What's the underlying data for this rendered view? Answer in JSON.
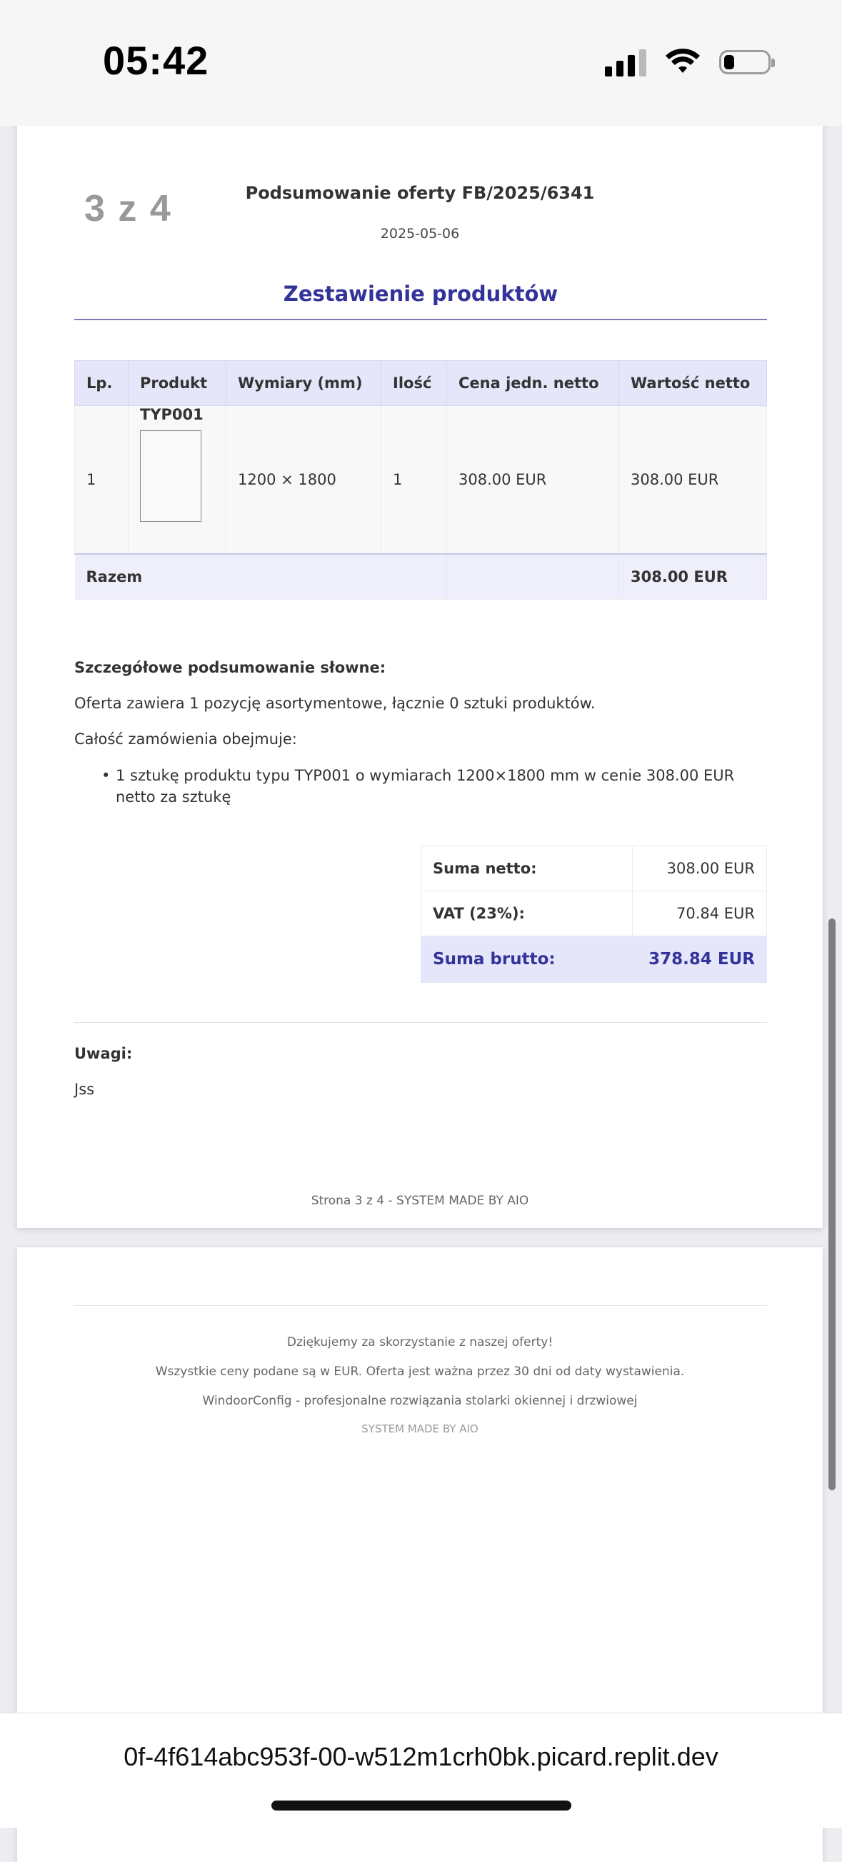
{
  "status_bar": {
    "time": "05:42",
    "icons": [
      "cellular-signal-icon",
      "wifi-icon",
      "battery-icon"
    ]
  },
  "page3": {
    "page_counter": "3 z 4",
    "title": "Podsumowanie oferty FB/2025/6341",
    "date": "2025-05-06",
    "section_heading": "Zestawienie produktów",
    "table": {
      "headers": [
        "Lp.",
        "Produkt",
        "Wymiary (mm)",
        "Ilość",
        "Cena jedn. netto",
        "Wartość netto"
      ],
      "rows": [
        {
          "lp": "1",
          "product": "TYP001",
          "dimensions": "1200 × 1800",
          "quantity": "1",
          "unit_price": "308.00 EUR",
          "net_value": "308.00 EUR"
        }
      ],
      "total_label": "Razem",
      "total_value": "308.00 EUR"
    },
    "summary": {
      "heading": "Szczegółowe podsumowanie słowne:",
      "line1": "Oferta zawiera 1 pozycję asortymentowe, łącznie 0 sztuki produktów.",
      "line2": "Całość zamówienia obejmuje:",
      "items": [
        "1 sztukę produktu typu TYP001 o wymiarach 1200×1800 mm w cenie 308.00 EUR netto za sztukę"
      ]
    },
    "totals": {
      "net_label": "Suma netto:",
      "net_value": "308.00 EUR",
      "vat_label": "VAT (23%):",
      "vat_value": "70.84 EUR",
      "gross_label": "Suma brutto:",
      "gross_value": "378.84 EUR"
    },
    "notes": {
      "heading": "Uwagi:",
      "text": "Jss"
    },
    "footer": "Strona 3 z 4 - SYSTEM MADE BY AIO"
  },
  "page4": {
    "thanks": "Dziękujemy za skorzystanie z naszej oferty!",
    "prices_note": "Wszystkie ceny podane są w EUR. Oferta jest ważna przez 30 dni od daty wystawienia.",
    "company": "WindoorConfig - profesjonalne rozwiązania stolarki okiennej i drzwiowej",
    "made_by": "SYSTEM MADE BY AIO"
  },
  "browser": {
    "url": "0f-4f614abc953f-00-w512m1crh0bk.picard.replit.dev"
  },
  "colors": {
    "accent": "#33339a",
    "table_header": "#e6e6fb"
  }
}
